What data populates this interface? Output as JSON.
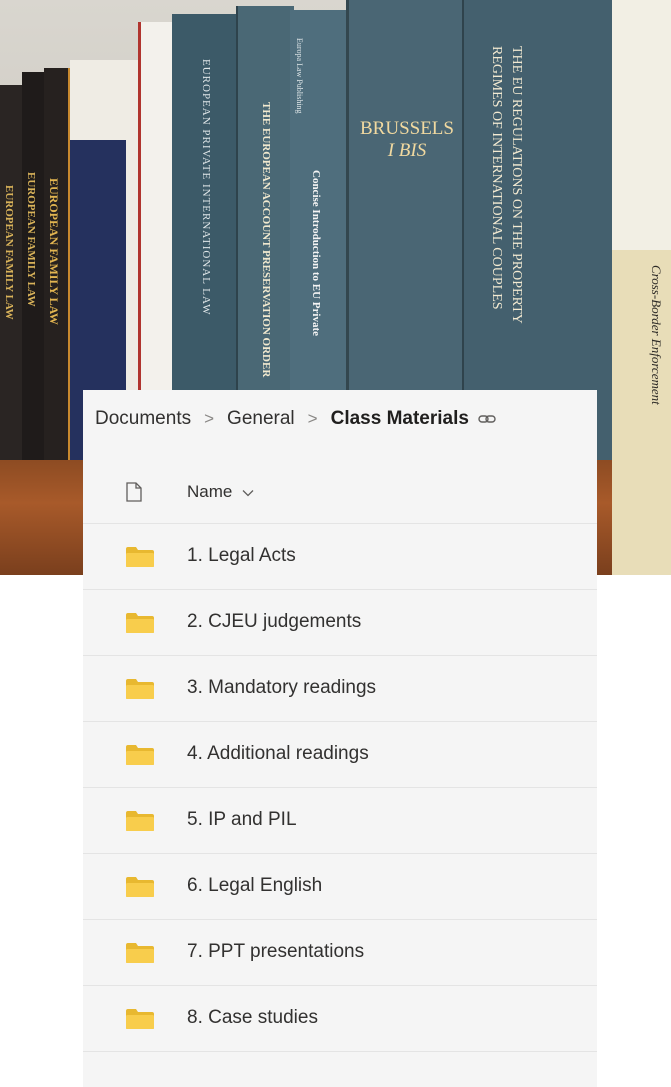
{
  "photo": {
    "spines": [
      "EUROPEAN FAMILY LAW",
      "EUROPEAN FAMILY LAW",
      "EUROPEAN FAMILY LAW",
      "EUROPEAN PRIVATE INTERNATIONAL LAW",
      "THE EUROPEAN ACCOUNT PRESERVATION ORDER",
      "Concise Introduction to EU Private",
      "THE EU REGULATIONS ON THE PROPERTY REGIMES OF INTERNATIONAL COUPLES",
      "Cross-Border Enforcement"
    ],
    "brussels_line1": "BRUSSELS",
    "brussels_line2": "I BIS",
    "publisher": "Europa Law Publishing"
  },
  "breadcrumb": {
    "items": [
      "Documents",
      "General"
    ],
    "current": "Class Materials",
    "separator": ">"
  },
  "list": {
    "header_label": "Name",
    "rows": [
      "1. Legal Acts",
      "2. CJEU judgements",
      "3. Mandatory readings",
      "4. Additional readings",
      "5. IP and PIL",
      "6. Legal English",
      "7. PPT presentations",
      "8. Case studies"
    ]
  },
  "colors": {
    "folder": "#f8cd4c",
    "panel_bg": "#f5f5f5",
    "divider": "#e4e4e4",
    "text": "#323130"
  },
  "icons": {
    "file": "file-icon",
    "folder": "folder-icon",
    "link": "link-icon",
    "chevron": "chevron-down-icon",
    "separator": "chevron-right-icon"
  }
}
